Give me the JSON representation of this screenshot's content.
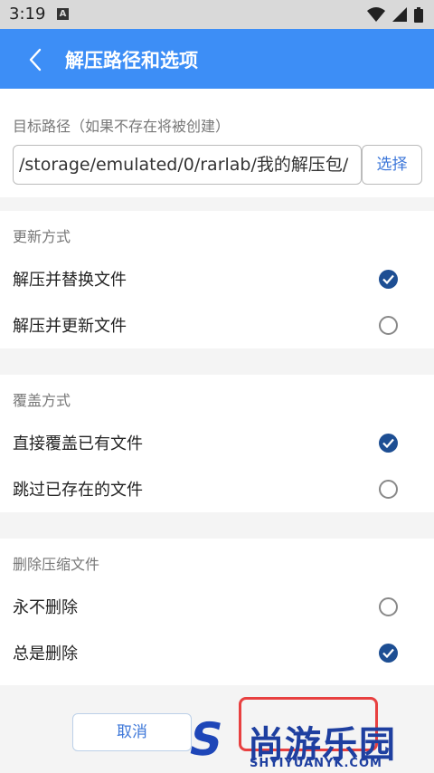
{
  "status": {
    "time": "3:19",
    "notif_letter": "A"
  },
  "appbar": {
    "title": "解压路径和选项"
  },
  "target": {
    "label": "目标路径（如果不存在将被创建）",
    "path": "/storage/emulated/0/rarlab/我的解压包/",
    "choose_button": "选择"
  },
  "update_mode": {
    "label": "更新方式",
    "options": [
      {
        "label": "解压并替换文件",
        "selected": true
      },
      {
        "label": "解压并更新文件",
        "selected": false
      }
    ]
  },
  "overwrite_mode": {
    "label": "覆盖方式",
    "options": [
      {
        "label": "直接覆盖已有文件",
        "selected": true
      },
      {
        "label": "跳过已存在的文件",
        "selected": false
      }
    ]
  },
  "delete_archive": {
    "label": "删除压缩文件",
    "options": [
      {
        "label": "永不删除",
        "selected": false
      },
      {
        "label": "总是删除",
        "selected": true
      }
    ]
  },
  "footer": {
    "cancel_label": "取消"
  },
  "watermark": {
    "text_cn": "尚游乐园",
    "text_en": "SHYIYUANYK.COM",
    "logo_letter": "S"
  },
  "colors": {
    "appbar": "#3d8ef6",
    "radio_selected": "#1d4e93",
    "button_text": "#3d77d9",
    "highlight": "#e84040"
  }
}
